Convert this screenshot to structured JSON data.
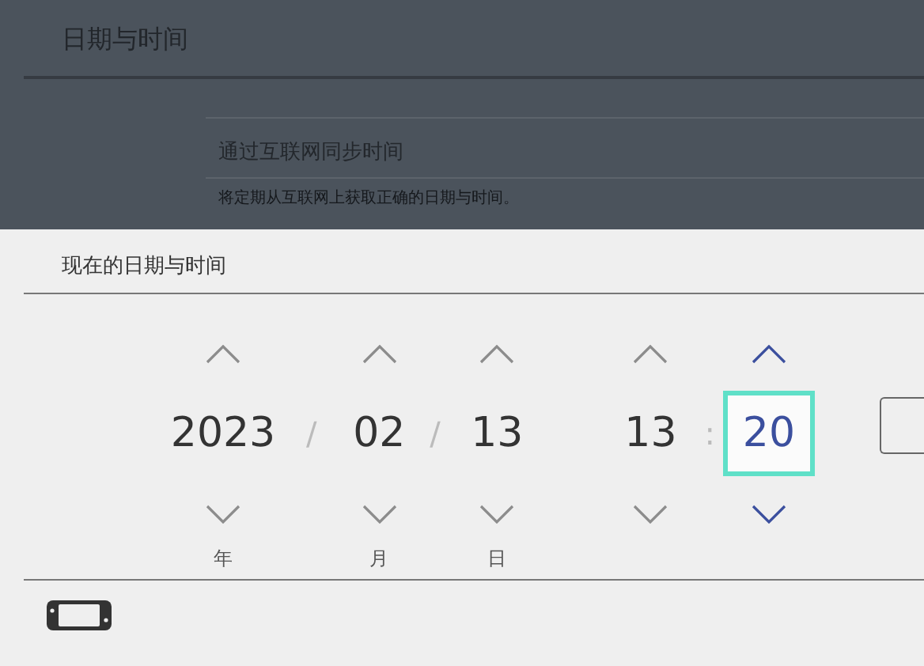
{
  "background": {
    "title": "日期与时间",
    "setting": {
      "label": "通过互联网同步时间",
      "description": "将定期从互联网上获取正确的日期与时间。"
    }
  },
  "sheet": {
    "title": "现在的日期与时间",
    "fields": [
      {
        "kind": "field",
        "value": "2023",
        "label": "年",
        "selected": false
      },
      {
        "kind": "separator",
        "value": "/"
      },
      {
        "kind": "field",
        "value": "02",
        "label": "月",
        "selected": false
      },
      {
        "kind": "separator",
        "value": "/"
      },
      {
        "kind": "field",
        "value": "13",
        "label": "日",
        "selected": false
      },
      {
        "kind": "gap"
      },
      {
        "kind": "field",
        "value": "13",
        "selected": false
      },
      {
        "kind": "separator",
        "value": ":"
      },
      {
        "kind": "field",
        "value": "20",
        "selected": true
      }
    ]
  }
}
